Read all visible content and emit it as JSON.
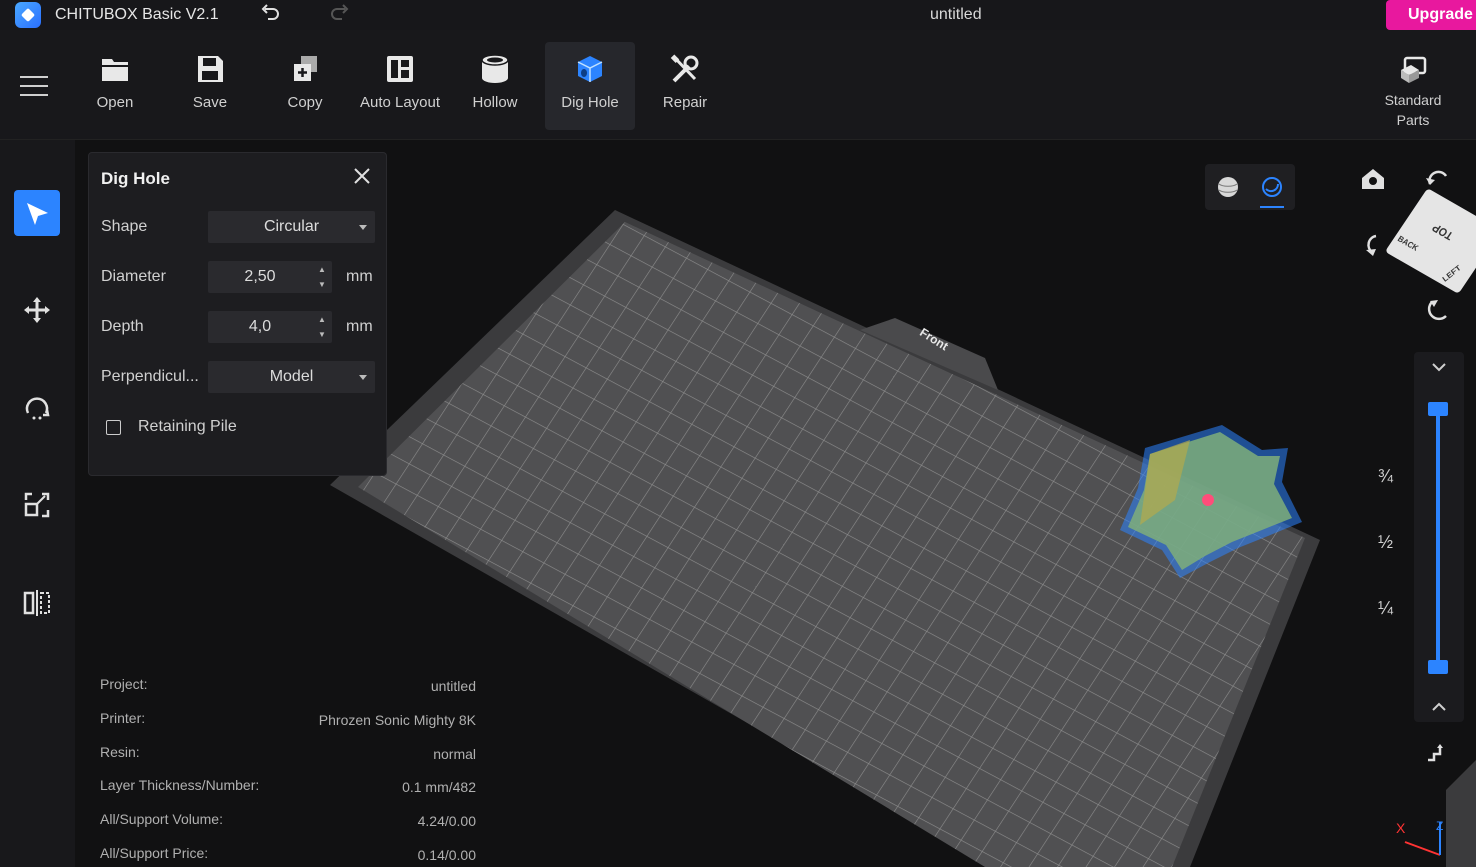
{
  "titlebar": {
    "app_title": "CHITUBOX Basic V2.1",
    "doc_title": "untitled",
    "upgrade_label": "Upgrade"
  },
  "toolbar": {
    "tools": [
      {
        "label": "Open",
        "icon": "folder-icon"
      },
      {
        "label": "Save",
        "icon": "floppy-icon"
      },
      {
        "label": "Copy",
        "icon": "copy-icon"
      },
      {
        "label": "Auto Layout",
        "icon": "layout-icon"
      },
      {
        "label": "Hollow",
        "icon": "hollow-icon"
      },
      {
        "label": "Dig Hole",
        "icon": "dig-hole-icon",
        "active": true
      },
      {
        "label": "Repair",
        "icon": "repair-icon"
      }
    ],
    "standard_parts_line1": "Standard",
    "standard_parts_line2": "Parts"
  },
  "panel": {
    "title": "Dig Hole",
    "shape_label": "Shape",
    "shape_value": "Circular",
    "diameter_label": "Diameter",
    "diameter_value": "2,50",
    "depth_label": "Depth",
    "depth_value": "4,0",
    "unit": "mm",
    "perpendicular_label": "Perpendicul...",
    "perpendicular_value": "Model",
    "retaining_pile_label": "Retaining Pile",
    "retaining_pile_checked": false
  },
  "info": [
    {
      "key": "Project:",
      "value": "untitled"
    },
    {
      "key": "Printer:",
      "value": "Phrozen Sonic Mighty 8K"
    },
    {
      "key": "Resin:",
      "value": "normal"
    },
    {
      "key": "Layer Thickness/Number:",
      "value": "0.1 mm/482"
    },
    {
      "key": "All/Support Volume:",
      "value": "4.24/0.00"
    },
    {
      "key": "All/Support Price:",
      "value": "0.14/0.00"
    }
  ],
  "viewport": {
    "plate_front_label": "Front",
    "cube_top": "TOP",
    "cube_back": "BACK",
    "cube_left": "LEFT",
    "axis_x": "X",
    "axis_z": "Z",
    "slider_marks": [
      "¾",
      "½",
      "¼"
    ]
  },
  "colors": {
    "accent": "#2c84ff",
    "upgrade": "#e8189e"
  }
}
